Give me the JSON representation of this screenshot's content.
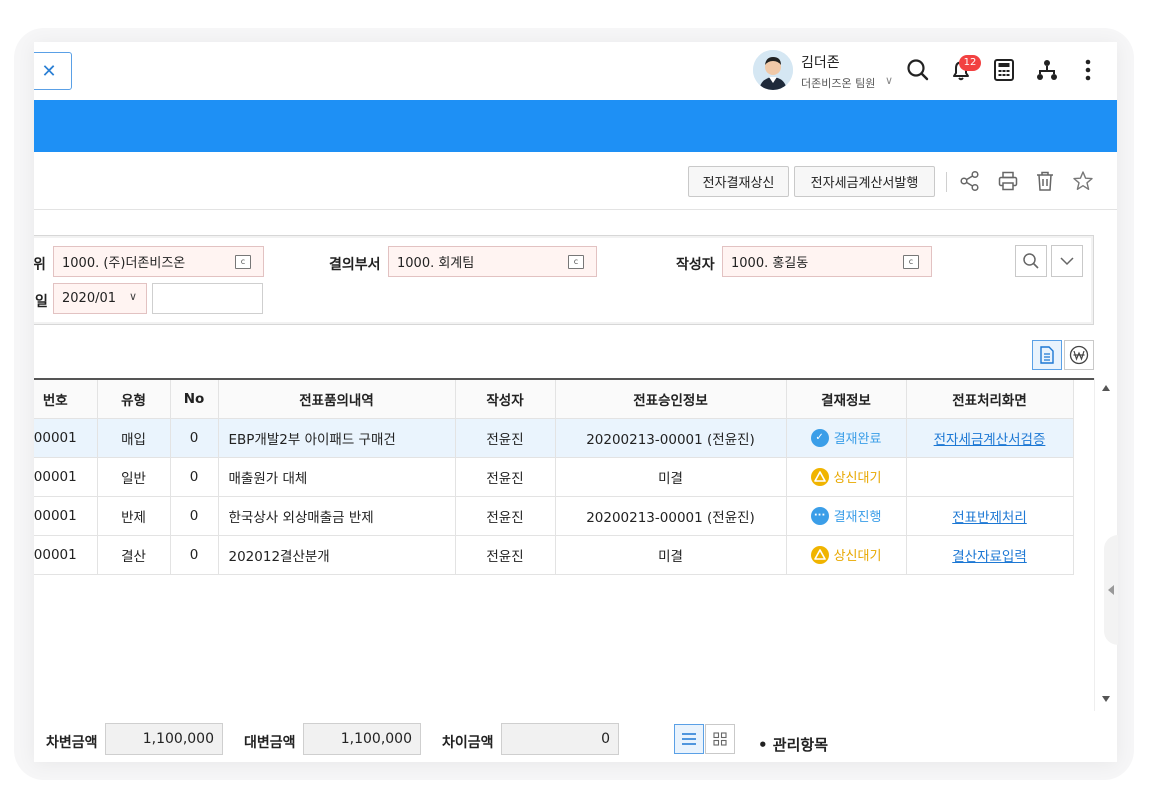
{
  "header": {
    "close_icon": "✕",
    "user": {
      "name": "김더존",
      "team": "더존비즈온 팀원",
      "chevron": "∨"
    },
    "notifications": {
      "count": "12"
    }
  },
  "toolbar": {
    "approval_label": "전자결재상신",
    "tax_invoice_label": "전자세금계산서발행",
    "icons": [
      "share-icon",
      "print-icon",
      "delete-icon",
      "star-icon"
    ]
  },
  "filter": {
    "unit_label": "위",
    "unit_value": "1000. (주)더존비즈온",
    "dept_label": "결의부서",
    "dept_value": "1000. 회계팀",
    "author_label": "작성자",
    "author_value": "1000. 홍길동",
    "date_label": "일",
    "date_value": "2020/01",
    "date_chevron": "∨",
    "cal_glyph": "c"
  },
  "grid": {
    "headers": [
      "번호",
      "유형",
      "No",
      "전표품의내역",
      "작성자",
      "전표승인정보",
      "결재정보",
      "전표처리화면"
    ],
    "rows": [
      {
        "num": "00001",
        "type": "매입",
        "no": "0",
        "desc": "EBP개발2부 아이패드 구매건",
        "author": "전윤진",
        "approval": "20200213-00001 (전윤진)",
        "status": "결재완료",
        "status_kind": "done",
        "action": "전자세금계산서검증"
      },
      {
        "num": "00001",
        "type": "일반",
        "no": "0",
        "desc": "매출원가 대체",
        "author": "전윤진",
        "approval": "미결",
        "status": "상신대기",
        "status_kind": "wait",
        "action": ""
      },
      {
        "num": "00001",
        "type": "반제",
        "no": "0",
        "desc": "한국상사 외상매출금 반제",
        "author": "전윤진",
        "approval": "20200213-00001 (전윤진)",
        "status": "결재진행",
        "status_kind": "progress",
        "action": "전표반제처리"
      },
      {
        "num": "00001",
        "type": "결산",
        "no": "0",
        "desc": "202012결산분개",
        "author": "전윤진",
        "approval": "미결",
        "status": "상신대기",
        "status_kind": "wait",
        "action": "결산자료입력"
      }
    ]
  },
  "footer": {
    "debit_label": "차변금액",
    "debit_value": "1,100,000",
    "credit_label": "대변금액",
    "credit_value": "1,100,000",
    "diff_label": "차이금액",
    "diff_value": "0",
    "mgmt_label": "• 관리항목"
  },
  "colors": {
    "brand_blue": "#1e90f5",
    "status_done": "#3b9ee8",
    "status_wait": "#f0b400",
    "status_progress": "#3b9ee8",
    "link": "#1d78d4",
    "badge": "#f24141"
  }
}
